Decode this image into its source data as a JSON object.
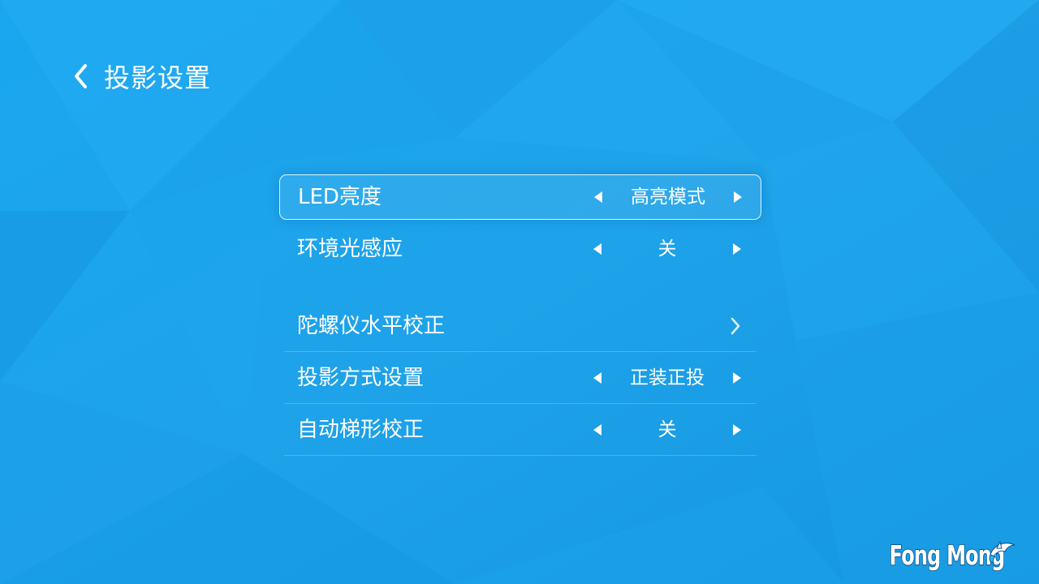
{
  "header": {
    "title": "投影设置"
  },
  "menu": {
    "items": [
      {
        "label": "LED亮度",
        "value": "高亮模式"
      },
      {
        "label": "环境光感应",
        "value": "关"
      },
      {
        "label": "陀螺仪水平校正"
      },
      {
        "label": "投影方式设置",
        "value": "正装正投"
      },
      {
        "label": "自动梯形校正",
        "value": "关"
      }
    ]
  },
  "brand": {
    "logo_text": "Fong Mong"
  },
  "colors": {
    "background": "#1ba6ee",
    "text": "#ffffff",
    "focus_border": "#ffffff"
  }
}
